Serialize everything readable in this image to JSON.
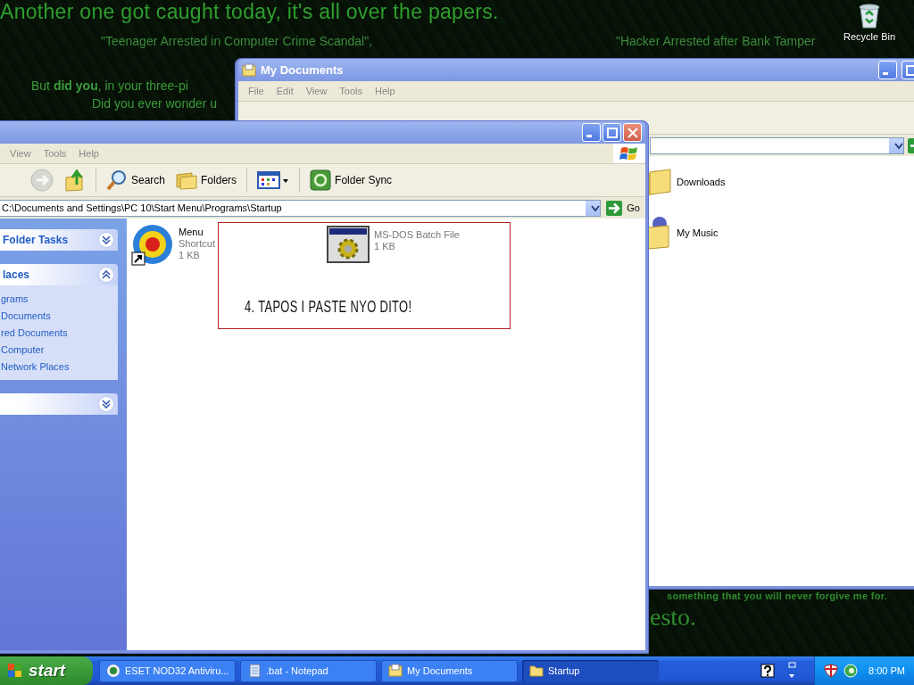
{
  "wallpaper": {
    "lines": [
      {
        "kind": "headline",
        "text": "Another one got caught today, it's all over the papers."
      },
      {
        "kind": "quote",
        "text": "\"Teenager Arrested in Computer Crime Scandal\","
      },
      {
        "kind": "quote-right",
        "text": "\"Hacker Arrested after Bank Tamper"
      },
      {
        "kind": "body",
        "text": "But **did you**, in your three-pi"
      },
      {
        "kind": "body2",
        "text": "Did you ever wonder u"
      },
      {
        "kind": "footer",
        "text": "something that you will **never** forgive me for."
      },
      {
        "kind": "signature",
        "text": "esto."
      }
    ]
  },
  "desktop_icons": [
    {
      "label": "Recycle Bin",
      "kind": "recycle-bin"
    }
  ],
  "back_window": {
    "title": "My Documents",
    "menu": [
      "File",
      "Edit",
      "View",
      "Tools",
      "Help"
    ],
    "items": [
      {
        "name": "Downloads",
        "kind": "folder"
      },
      {
        "name": "My Music",
        "kind": "music"
      }
    ]
  },
  "front_window": {
    "menu": [
      "View",
      "Tools",
      "Help"
    ],
    "toolbar": [
      {
        "kind": "forward",
        "disabled": true
      },
      {
        "kind": "up",
        "disabled": false
      },
      {
        "kind": "search",
        "label": "Search",
        "disabled": false
      },
      {
        "kind": "folders",
        "label": "Folders",
        "disabled": false
      },
      {
        "kind": "views",
        "disabled": false
      },
      {
        "kind": "sync",
        "label": "Folder Sync",
        "disabled": false
      }
    ],
    "address": "C:\\Documents and Settings\\PC 10\\Start Menu\\Programs\\Startup",
    "go": "Go",
    "panels": [
      {
        "title": "Folder Tasks",
        "expanded": false
      },
      {
        "title": "laces",
        "expanded": true,
        "items": [
          "grams",
          "Documents",
          "red Documents",
          "Computer",
          "Network Places"
        ]
      },
      {
        "expanded": false
      }
    ],
    "items": [
      {
        "kind": "shortcut",
        "name": "Menu",
        "type": "Shortcut",
        "size": "1 KB"
      },
      {
        "kind": "batch",
        "type": "MS-DOS Batch File",
        "size": "1 KB"
      }
    ],
    "annotation": "4. TAPOS I PASTE NYO DITO!"
  },
  "taskbar": {
    "start": "start",
    "tasks": [
      {
        "label": "ESET NOD32 Antiviru...",
        "kind": "antivirus",
        "selected": false
      },
      {
        "label": ".bat - Notepad",
        "kind": "notepad",
        "selected": false
      },
      {
        "label": "My Documents",
        "kind": "explorer",
        "selected": false
      },
      {
        "label": "Startup",
        "kind": "folder",
        "selected": true
      }
    ],
    "clock": "8:00 PM"
  }
}
